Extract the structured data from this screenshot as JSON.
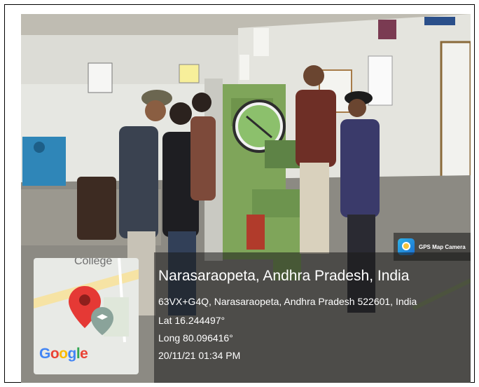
{
  "photo": {
    "description_icon": "photo-classroom-scene"
  },
  "gps_badge": {
    "label": "GPS Map Camera",
    "icon": "camera-pin-icon"
  },
  "map": {
    "label": "College",
    "logo_text": "Google",
    "marker_icon": "map-marker-icon",
    "college_icon": "graduation-cap-icon"
  },
  "location": {
    "title": "Narasaraopeta, Andhra Pradesh, India",
    "address": "63VX+G4Q, Narasaraopeta, Andhra Pradesh 522601, India",
    "lat": "Lat 16.244497°",
    "long": "Long 80.096416°",
    "datetime": "20/11/21 01:34 PM"
  },
  "colors": {
    "overlay": "#191919",
    "marker": "#e53935",
    "machine": "#7fa55a"
  }
}
